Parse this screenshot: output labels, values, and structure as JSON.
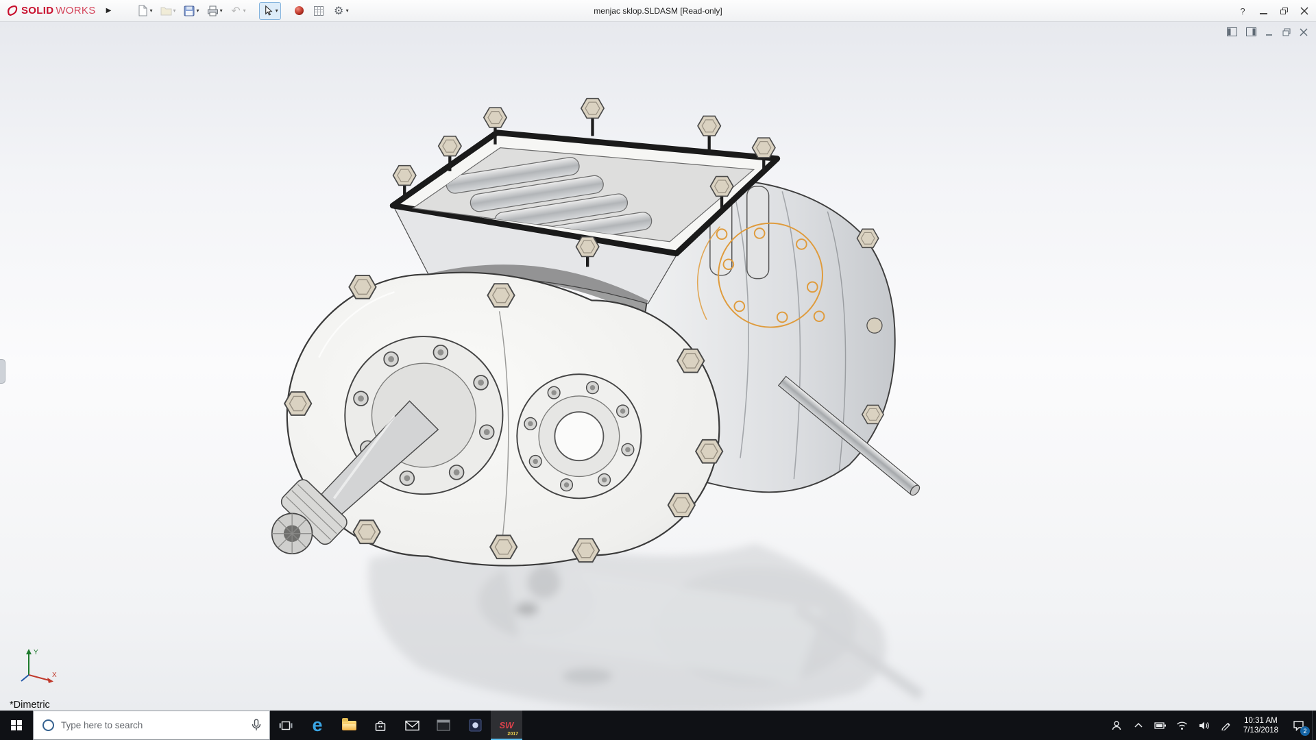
{
  "window": {
    "brand_solid": "SOLID",
    "brand_works": "WORKS",
    "title": "menjac sklop.SLDASM [Read-only]",
    "help_label": "?"
  },
  "glyphs": {
    "dropdown": "▾",
    "expand": "▶",
    "undo": "↶",
    "gear": "⚙"
  },
  "toolbar_icons": [
    "new-document",
    "open",
    "save",
    "print",
    "undo",
    "select",
    "appearance",
    "design-table",
    "options"
  ],
  "viewport": {
    "view_label": "*Dimetric",
    "triad_x": "X",
    "triad_y": "Y"
  },
  "taskbar": {
    "search_placeholder": "Type here to search",
    "edge_glyph": "e",
    "solidworks": {
      "text": "SW",
      "year": "2017"
    },
    "tray": {
      "time": "10:31 AM",
      "date": "7/13/2018",
      "notification_count": "2"
    }
  }
}
